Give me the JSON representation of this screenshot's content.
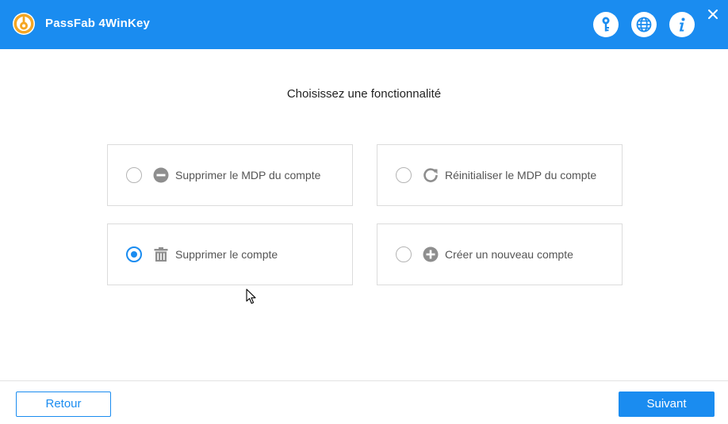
{
  "app": {
    "title": "PassFab 4WinKey",
    "logo_icon": "key-lock-logo-icon",
    "accent_color": "#1a8cf0"
  },
  "header": {
    "icons": [
      "key-icon",
      "globe-icon",
      "info-icon",
      "close-icon"
    ]
  },
  "main": {
    "heading": "Choisissez une fonctionnalité",
    "options": [
      {
        "label": "Supprimer le MDP du compte",
        "icon": "minus-circle-icon",
        "selected": false
      },
      {
        "label": "Réinitialiser le MDP du compte",
        "icon": "refresh-icon",
        "selected": false
      },
      {
        "label": "Supprimer le compte",
        "icon": "trash-icon",
        "selected": true
      },
      {
        "label": "Créer un nouveau compte",
        "icon": "plus-circle-icon",
        "selected": false
      }
    ]
  },
  "footer": {
    "back_label": "Retour",
    "next_label": "Suivant"
  }
}
